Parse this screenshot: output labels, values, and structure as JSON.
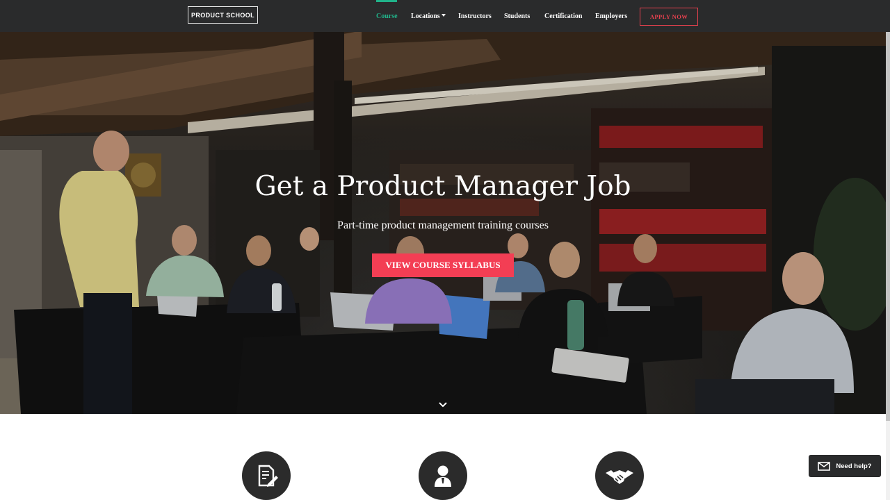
{
  "nav": {
    "logo": "PRODUCT SCHOOL",
    "links": [
      "Course",
      "Locations",
      "Instructors",
      "Students",
      "Certification",
      "Employers"
    ],
    "active": "Course",
    "apply_label": "APPLY NOW"
  },
  "hero": {
    "title": "Get a Product Manager Job",
    "subtitle": "Part-time product management training courses",
    "cta_label": "VIEW COURSE SYLLABUS"
  },
  "features": {
    "icons": [
      "document-edit-icon",
      "instructor-icon",
      "handshake-icon"
    ]
  },
  "help_widget": {
    "label": "Need help?",
    "icon": "envelope-icon"
  },
  "colors": {
    "nav_bg": "#2a2b2c",
    "active": "#21b38a",
    "accent": "#f33e54",
    "apply_border": "#e9414f",
    "icon_circle": "#2b2b2b"
  }
}
